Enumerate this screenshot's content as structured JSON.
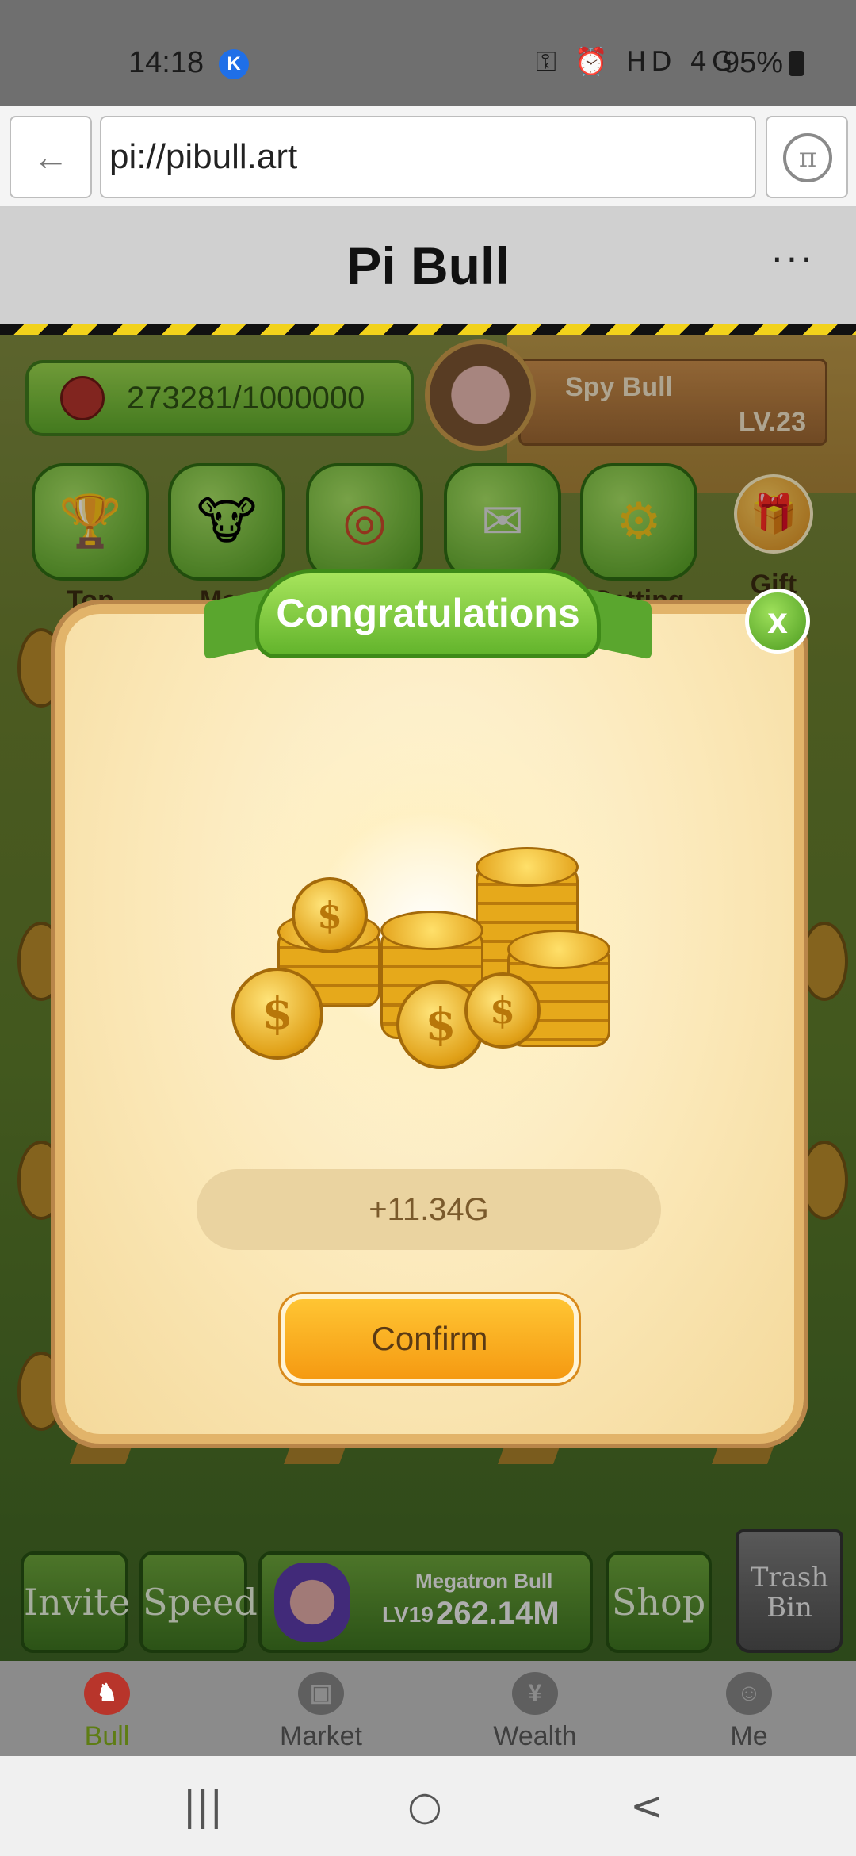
{
  "status_bar": {
    "time": "14:18",
    "app_badge": "K",
    "network": "HD 4G",
    "battery": "95%"
  },
  "browser": {
    "back_glyph": "←",
    "url": "pi://pibull.art",
    "pi_glyph": "π"
  },
  "header": {
    "title": "Pi Bull",
    "more_glyph": "···"
  },
  "game": {
    "coin_progress": "273281/1000000",
    "player_name": "Spy Bull",
    "player_level": "LV.23",
    "menu": [
      {
        "label": "Top",
        "icon": "podium-icon"
      },
      {
        "label": "Map",
        "icon": "bull-icon"
      },
      {
        "label": "",
        "icon": "wheel-icon"
      },
      {
        "label": "",
        "icon": "mail-icon"
      },
      {
        "label": "Setting",
        "icon": "gear-icon"
      },
      {
        "label": "Gift",
        "icon": "gift-icon"
      }
    ],
    "bottom": {
      "invite": "Invite",
      "speed": "Speed",
      "mega_name": "Megatron Bull",
      "mega_level": "LV19",
      "mega_value": "262.14M",
      "shop": "Shop",
      "trash": "Trash Bin"
    }
  },
  "modal": {
    "title": "Congratulations",
    "close_glyph": "x",
    "reward": "+11.34G",
    "confirm_label": "Confirm",
    "coin_symbol": "$"
  },
  "tabs": [
    {
      "label": "Bull",
      "icon": "bull-icon",
      "active": true
    },
    {
      "label": "Market",
      "icon": "store-icon",
      "active": false
    },
    {
      "label": "Wealth",
      "icon": "money-bag-icon",
      "active": false
    },
    {
      "label": "Me",
      "icon": "face-icon",
      "active": false
    }
  ],
  "system_nav": {
    "recents": "|||",
    "home": "○",
    "back": "<"
  },
  "colors": {
    "accent_green": "#63b42c",
    "confirm_orange": "#f59a12",
    "active_tab": "#5e7d14"
  }
}
